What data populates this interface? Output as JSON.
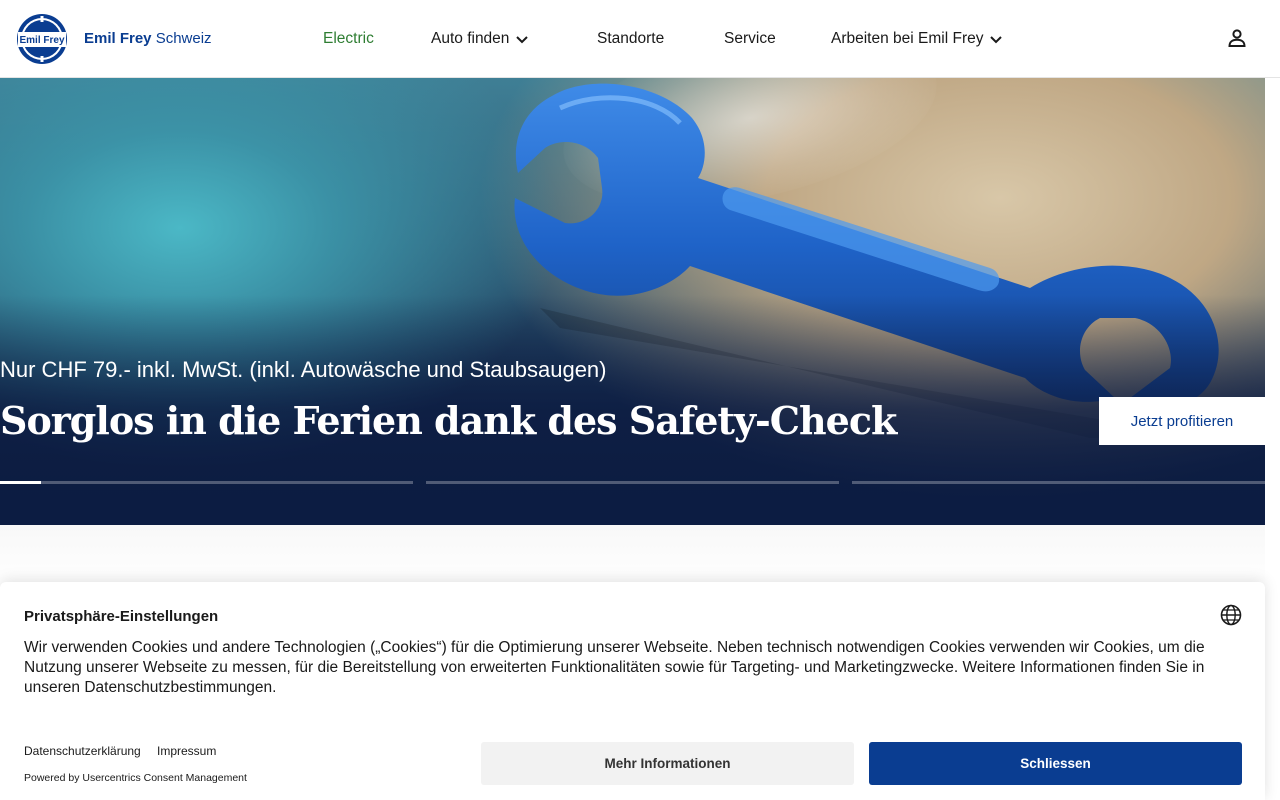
{
  "header": {
    "brand_bold": "Emil Frey",
    "brand_regular": "Schweiz",
    "nav": [
      {
        "label": "Electric",
        "active": true,
        "dropdown": false
      },
      {
        "label": "Auto finden",
        "active": false,
        "dropdown": true
      },
      {
        "label": "Standorte",
        "active": false,
        "dropdown": false
      },
      {
        "label": "Service",
        "active": false,
        "dropdown": false
      },
      {
        "label": "Arbeiten bei Emil Frey",
        "active": false,
        "dropdown": true
      }
    ],
    "logo_text": "Emil Frey",
    "user_icon": "user-icon"
  },
  "hero": {
    "subtitle": "Nur CHF 79.- inkl. MwSt. (inkl. Autowäsche und Staubsaugen)",
    "title": "Sorglos in die Ferien dank des Safety-Check",
    "cta": "Jetzt profitieren",
    "slides": {
      "count": 3,
      "active_index": 0,
      "active_progress": 0.1
    }
  },
  "cookie": {
    "title": "Privatsphäre-Einstellungen",
    "text": "Wir verwenden Cookies und andere Technologien („Cookies“) für die Optimierung unserer Webseite. Neben technisch notwendigen Cookies verwenden wir Cookies, um die Nutzung unserer Webseite zu messen, für die Bereitstellung von erweiterten Funktionalitäten sowie für Targeting- und Marketingzwecke. Weitere Informationen finden Sie in unseren Datenschutzbestimmungen.",
    "links": [
      "Datenschutzerklärung",
      "Impressum"
    ],
    "powered_by": "Powered by Usercentrics Consent Management",
    "btn_more": "Mehr Informationen",
    "btn_close": "Schliessen"
  },
  "colors": {
    "brand_blue": "#0a3d91",
    "active_green": "#2e7d32"
  }
}
